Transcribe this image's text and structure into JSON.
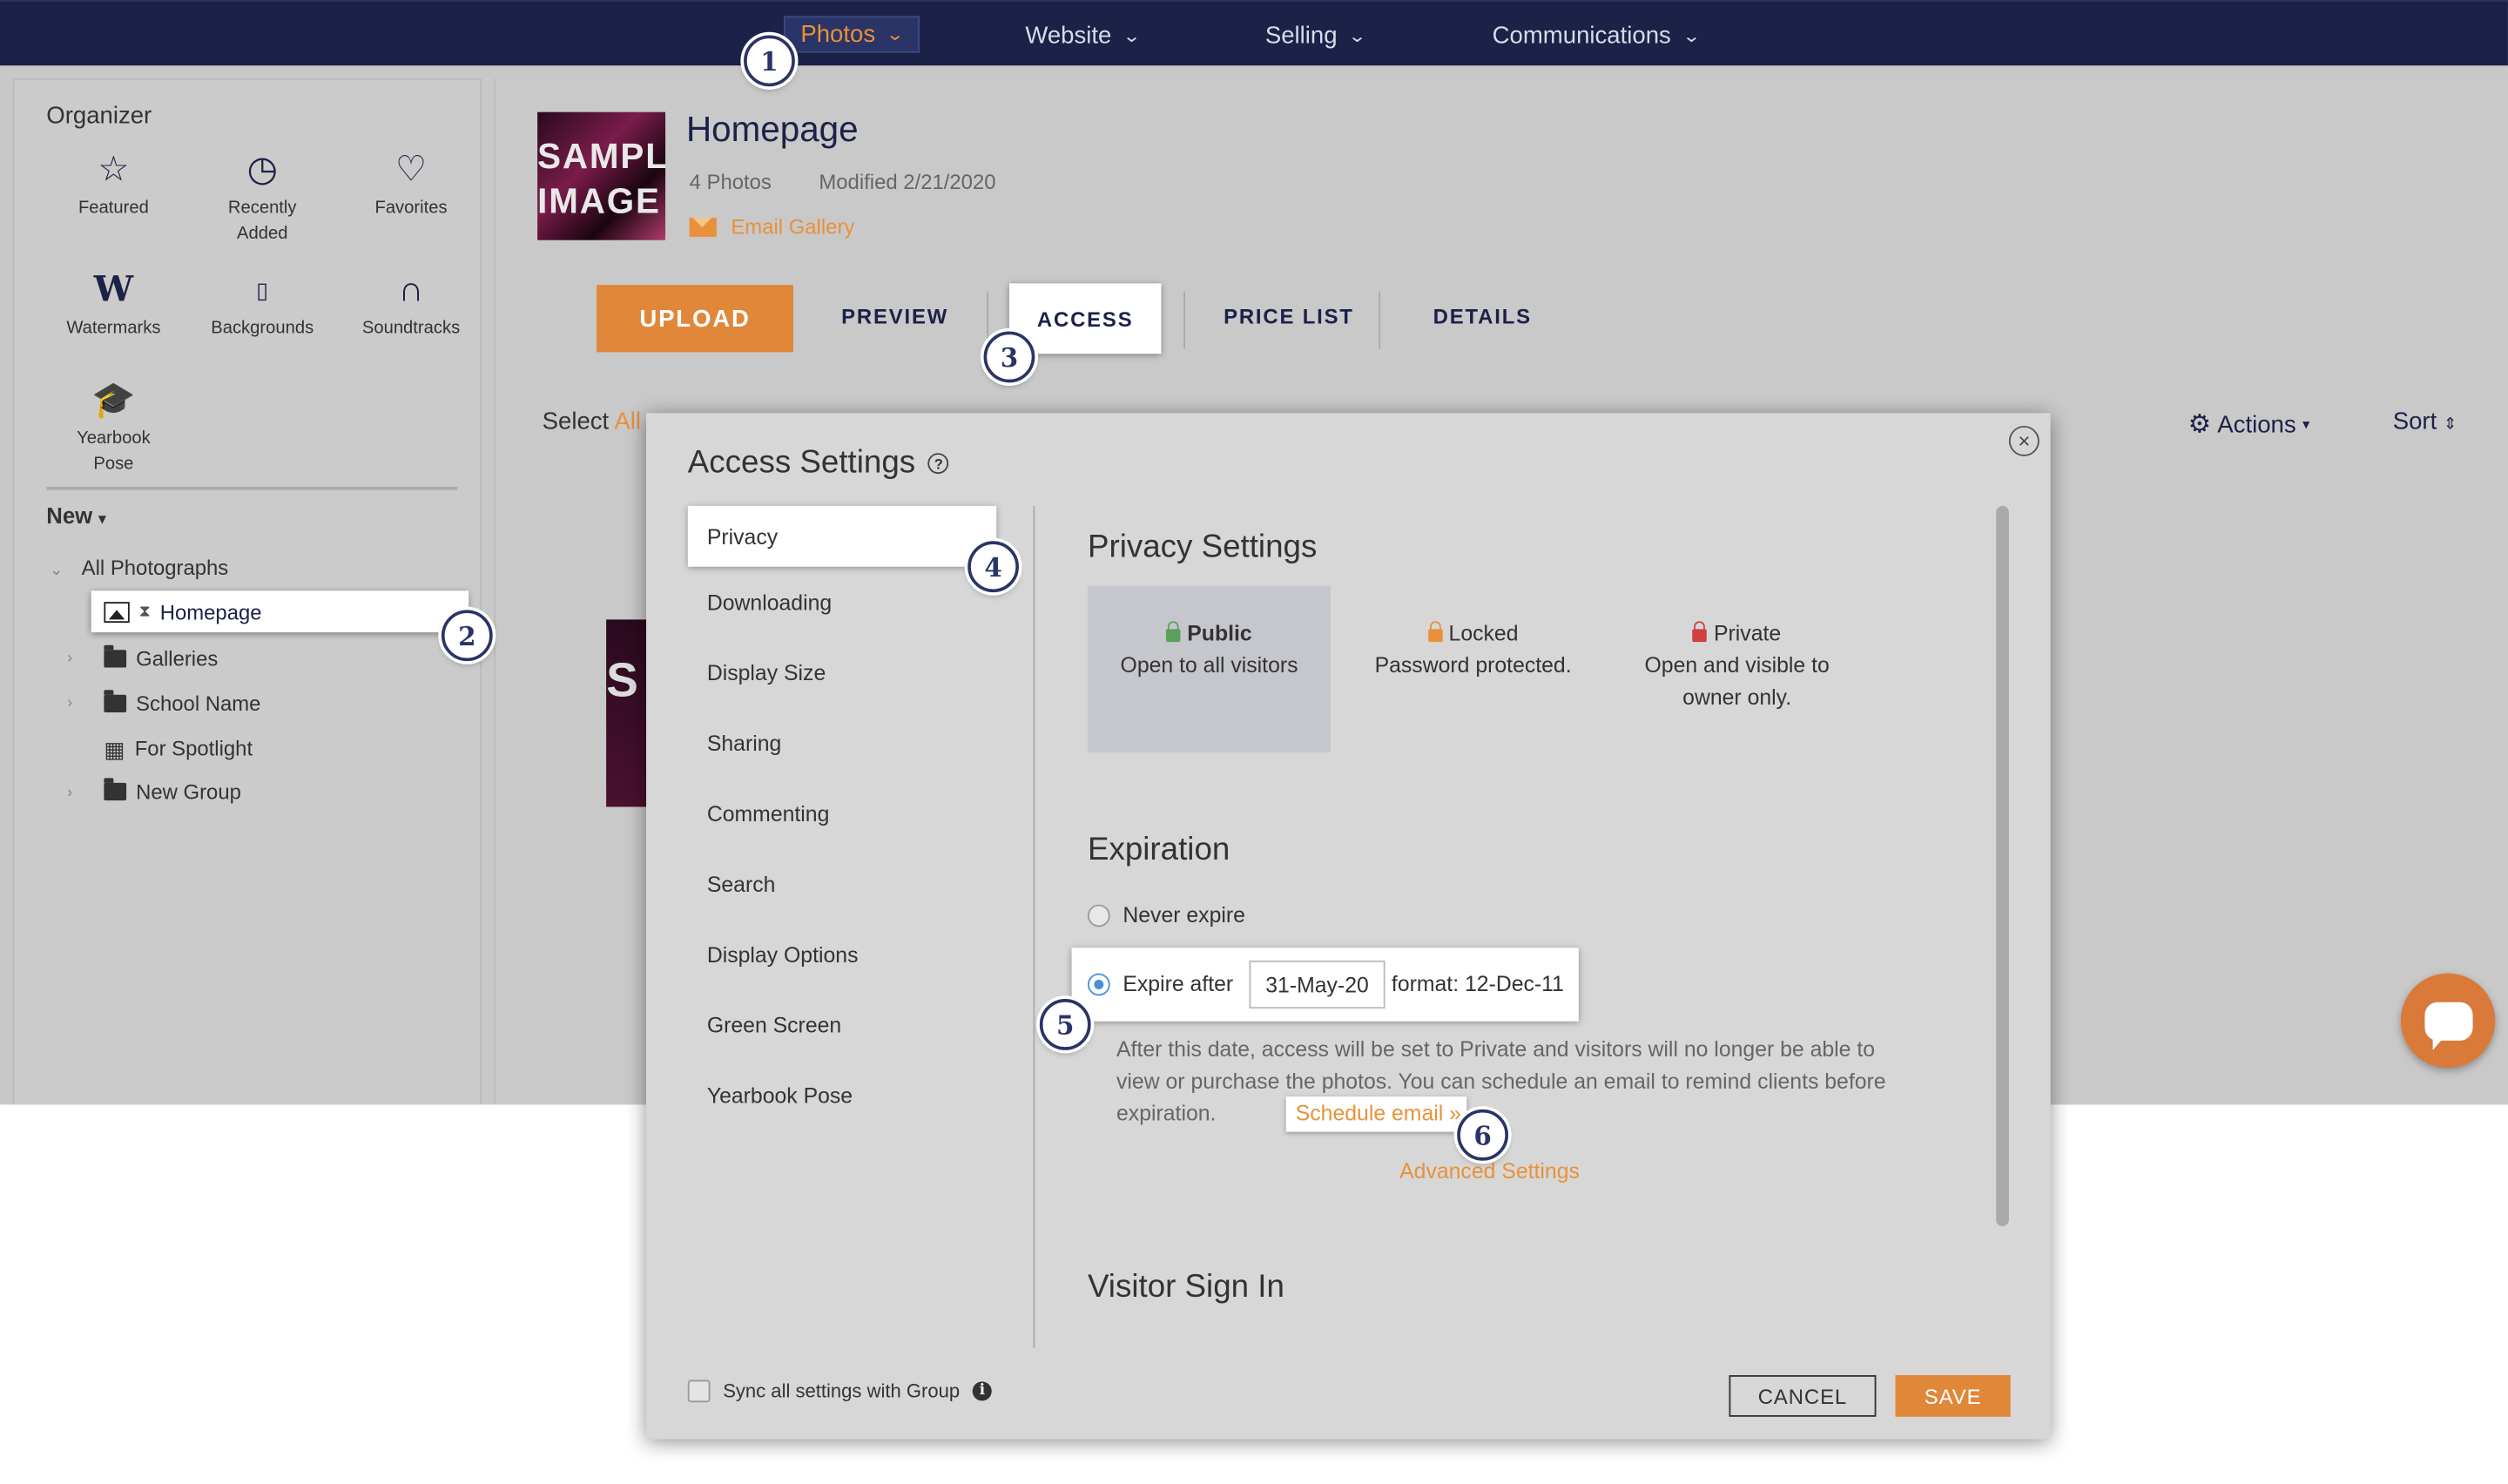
{
  "topnav": {
    "items": [
      {
        "label": "Photos",
        "active": true
      },
      {
        "label": "Website"
      },
      {
        "label": "Selling"
      },
      {
        "label": "Communications"
      }
    ]
  },
  "organizer": {
    "title": "Organizer",
    "tiles": [
      {
        "label": "Featured",
        "icon": "star-icon"
      },
      {
        "label": "Recently Added",
        "icon": "clock-icon"
      },
      {
        "label": "Favorites",
        "icon": "heart-icon"
      },
      {
        "label": "Watermarks",
        "icon": "watermark-w-icon"
      },
      {
        "label": "Backgrounds",
        "icon": "background-icon"
      },
      {
        "label": "Soundtracks",
        "icon": "headphones-icon"
      },
      {
        "label": "Yearbook Pose",
        "icon": "graduation-cap-icon"
      }
    ],
    "new_label": "New",
    "tree": {
      "root": "All Photographs",
      "selected": "Homepage",
      "items": [
        "Galleries",
        "School Name",
        "For Spotlight",
        "New Group"
      ]
    }
  },
  "gallery": {
    "thumb_text": "SAMPLE IMAGE",
    "title": "Homepage",
    "photos": "4 Photos",
    "modified": "Modified 2/21/2020",
    "email_link": "Email Gallery",
    "upload": "UPLOAD",
    "tabs": [
      "PREVIEW",
      "ACCESS",
      "PRICE LIST",
      "DETAILS"
    ],
    "active_tab": "ACCESS",
    "select_label": "Select",
    "select_all": "All",
    "actions": "Actions",
    "sort": "Sort"
  },
  "modal": {
    "title": "Access Settings",
    "nav": [
      "Privacy",
      "Downloading",
      "Display Size",
      "Sharing",
      "Commenting",
      "Search",
      "Display Options",
      "Green Screen",
      "Yearbook Pose"
    ],
    "active_nav": "Privacy",
    "privacy": {
      "title": "Privacy Settings",
      "options": [
        {
          "name": "Public",
          "desc": "Open to all visitors",
          "selected": true,
          "lock_color": "#5aa05a"
        },
        {
          "name": "Locked",
          "desc": "Password protected.",
          "lock_color": "#e8913a"
        },
        {
          "name": "Private",
          "desc": "Open and visible to owner only.",
          "lock_color": "#d04040"
        }
      ]
    },
    "expiration": {
      "title": "Expiration",
      "never": "Never expire",
      "after": "Expire after",
      "date": "31-May-20",
      "format": "format: 12-Dec-11",
      "desc": "After this date, access will be set to Private and visitors will no longer be able to view or purchase the photos. You can schedule an email to remind clients before expiration.",
      "schedule": "Schedule email »",
      "advanced": "Advanced Settings"
    },
    "visitor_title": "Visitor Sign In",
    "sync": "Sync all settings with Group",
    "cancel": "CANCEL",
    "save": "SAVE"
  },
  "steps": [
    "1",
    "2",
    "3",
    "4",
    "5",
    "6"
  ],
  "colors": {
    "nav_bg": "#1c2148",
    "accent": "#e0873a",
    "step_border": "#2a3466"
  }
}
